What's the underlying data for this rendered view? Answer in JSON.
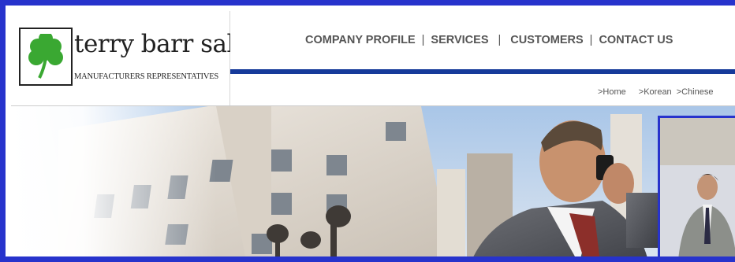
{
  "brand": {
    "name": "terry barr sales",
    "tagline": "MANUFACTURERS REPRESENTATIVES"
  },
  "nav": {
    "items": [
      "COMPANY PROFILE",
      "SERVICES",
      "CUSTOMERS",
      "CONTACT US"
    ],
    "separator": "|"
  },
  "languages": [
    ">Home",
    ">Korean",
    ">Chinese"
  ],
  "colors": {
    "frame": "#2733cc",
    "rule": "#163a9a",
    "clover": "#3aa832"
  },
  "icons": {
    "logo": "shamrock-icon"
  }
}
